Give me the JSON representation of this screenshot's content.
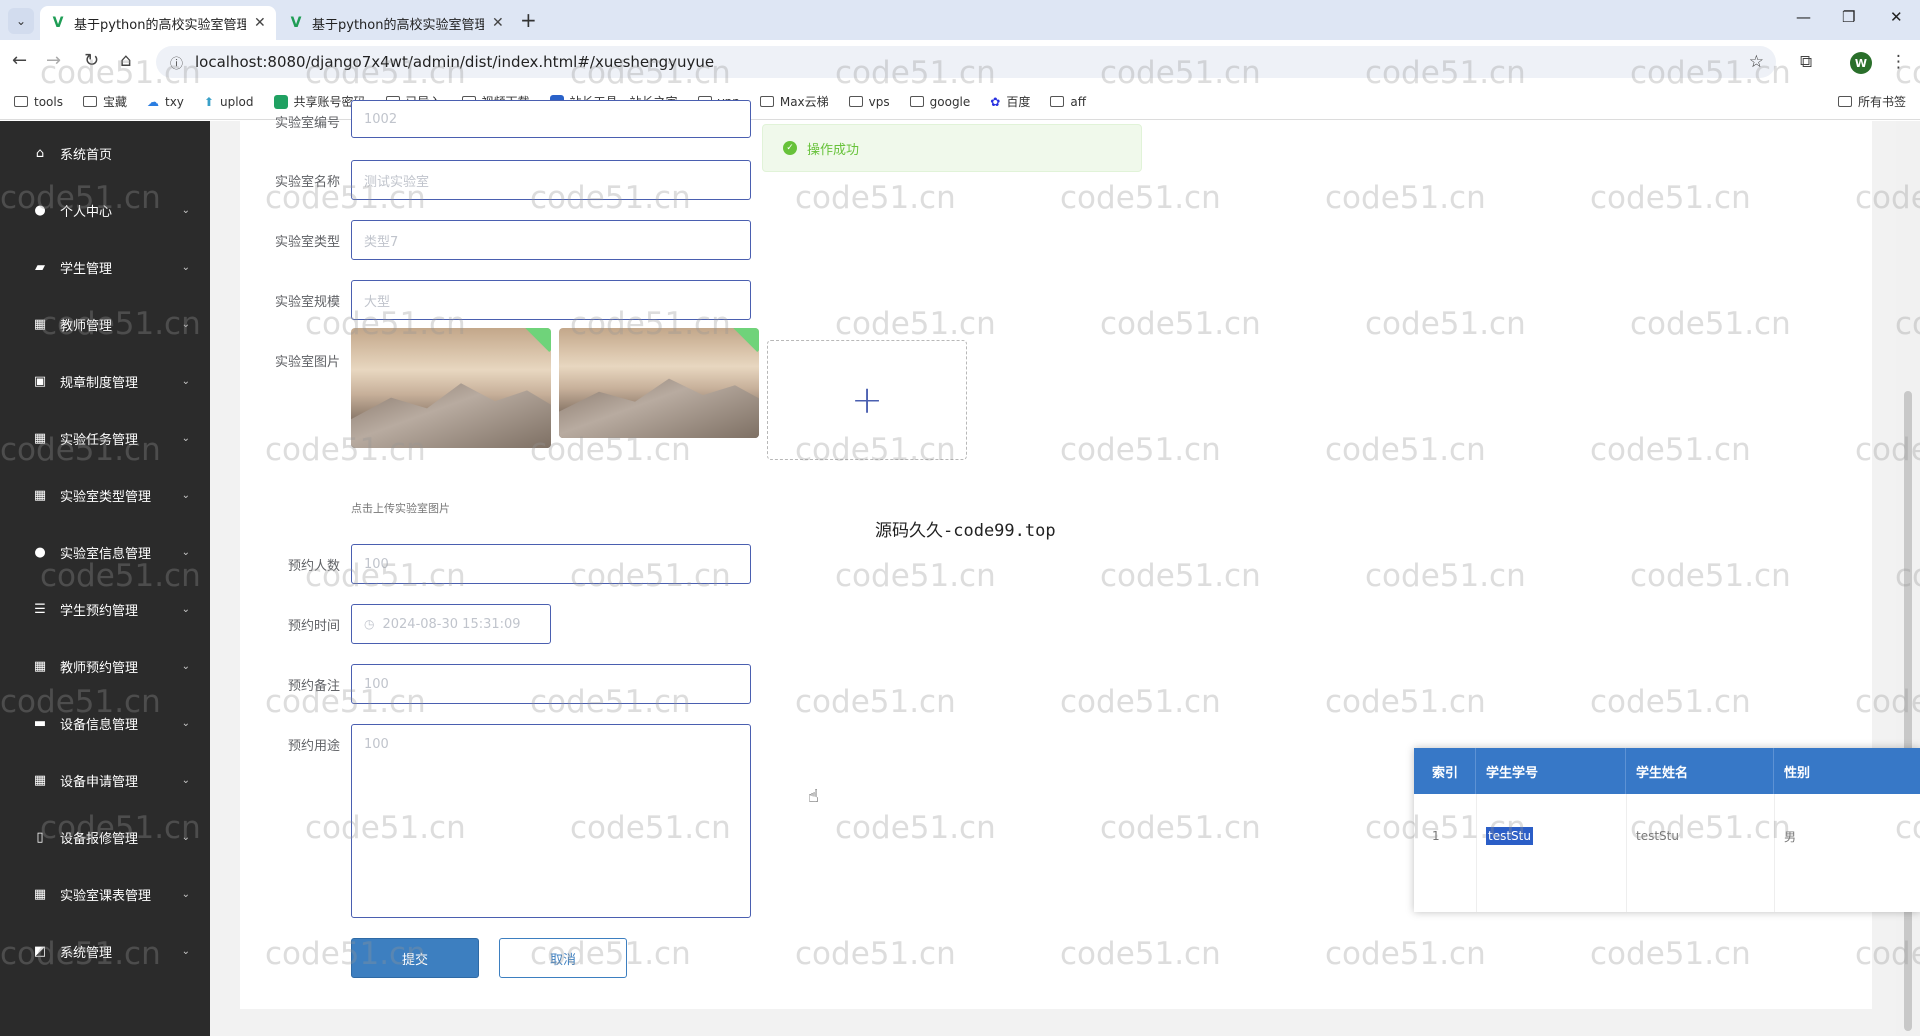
{
  "browser": {
    "tabs": [
      {
        "title": "基于python的高校实验室管理系"
      },
      {
        "title": "基于python的高校实验室管理系"
      }
    ],
    "url": "localhost:8080/django7x4wt/admin/dist/index.html#/xueshengyuyue",
    "profile_initial": "W"
  },
  "bookmarks": {
    "items": [
      "tools",
      "宝藏",
      "txy",
      "uplod",
      "共享账号密码",
      "已导入",
      "视频下载",
      "站长工具 - 站长之家",
      "vpn",
      "Max云梯",
      "vps",
      "google",
      "百度",
      "aff"
    ],
    "all_label": "所有书签"
  },
  "sidebar": {
    "items": [
      {
        "label": "系统首页",
        "icon": "home-icon",
        "has_children": false
      },
      {
        "label": "个人中心",
        "icon": "user-icon",
        "has_children": true
      },
      {
        "label": "学生管理",
        "icon": "briefcase-icon",
        "has_children": true
      },
      {
        "label": "教师管理",
        "icon": "grid-icon",
        "has_children": true
      },
      {
        "label": "规章制度管理",
        "icon": "clipboard-icon",
        "has_children": true
      },
      {
        "label": "实验任务管理",
        "icon": "grid-icon",
        "has_children": true
      },
      {
        "label": "实验室类型管理",
        "icon": "grid-icon",
        "has_children": true
      },
      {
        "label": "实验室信息管理",
        "icon": "user-icon",
        "has_children": true
      },
      {
        "label": "学生预约管理",
        "icon": "list-icon",
        "has_children": true
      },
      {
        "label": "教师预约管理",
        "icon": "grid-icon",
        "has_children": true
      },
      {
        "label": "设备信息管理",
        "icon": "chat-icon",
        "has_children": true
      },
      {
        "label": "设备申请管理",
        "icon": "grid-icon",
        "has_children": true
      },
      {
        "label": "设备报修管理",
        "icon": "tablet-icon",
        "has_children": true
      },
      {
        "label": "实验室课表管理",
        "icon": "grid-icon",
        "has_children": true
      },
      {
        "label": "系统管理",
        "icon": "chart-icon",
        "has_children": true
      }
    ]
  },
  "form": {
    "lab_number": {
      "label": "实验室编号",
      "value": "1002"
    },
    "lab_name": {
      "label": "实验室名称",
      "value": "测试实验室"
    },
    "lab_type": {
      "label": "实验室类型",
      "value": "类型7"
    },
    "lab_scale": {
      "label": "实验室规模",
      "value": "大型"
    },
    "lab_image": {
      "label": "实验室图片",
      "tip": "点击上传实验室图片",
      "add_symbol": "+"
    },
    "reserve_count": {
      "label": "预约人数",
      "value": "100"
    },
    "reserve_time": {
      "label": "预约时间",
      "value": "2024-08-30 15:31:09"
    },
    "reserve_note": {
      "label": "预约备注",
      "value": "100"
    },
    "reserve_purpose": {
      "label": "预约用途",
      "value": "100"
    },
    "submit_label": "提交",
    "cancel_label": "取消"
  },
  "message": {
    "text": "操作成功",
    "color": "#67c23a"
  },
  "overlay_text": "源码久久-code99.top",
  "popup_table": {
    "columns": [
      "索引",
      "学生学号",
      "学生姓名",
      "性别"
    ],
    "rows": [
      {
        "index": "1",
        "student_no": "testStu",
        "student_name": "testStu",
        "gender": "男"
      }
    ]
  },
  "watermark": "code51.cn",
  "colors": {
    "primary": "#3d7fc0",
    "sidebar": "#2b2b2b",
    "table_header": "#3778c7",
    "input_border": "#4a5fb0"
  }
}
